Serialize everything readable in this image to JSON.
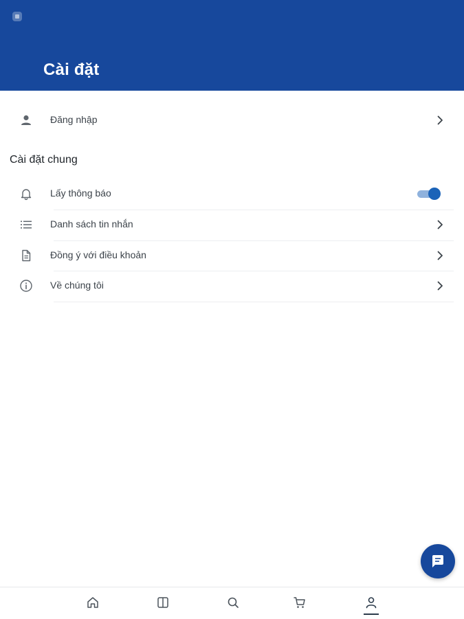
{
  "header": {
    "title": "Cài đặt"
  },
  "account": {
    "login_label": "Đăng nhập",
    "icon": "person-icon"
  },
  "general": {
    "section_title": "Cài đặt chung",
    "items": [
      {
        "label": "Lấy thông báo",
        "icon": "bell-icon",
        "toggle": true,
        "enabled": true
      },
      {
        "label": "Danh sách tin nhắn",
        "icon": "list-icon"
      },
      {
        "label": "Đồng ý với điều khoản",
        "icon": "document-icon"
      },
      {
        "label": "Về chúng tôi",
        "icon": "info-icon"
      }
    ]
  },
  "fab": {
    "icon": "chat-icon"
  },
  "bottom_nav": {
    "items": [
      {
        "icon": "home-icon"
      },
      {
        "icon": "book-icon"
      },
      {
        "icon": "search-icon"
      },
      {
        "icon": "cart-icon"
      },
      {
        "icon": "profile-icon",
        "active": true
      }
    ]
  },
  "colors": {
    "header_bg": "#17489c",
    "toggle_on": "#1b63b8",
    "toggle_track": "#8fb2dd",
    "text": "#3b4249"
  }
}
